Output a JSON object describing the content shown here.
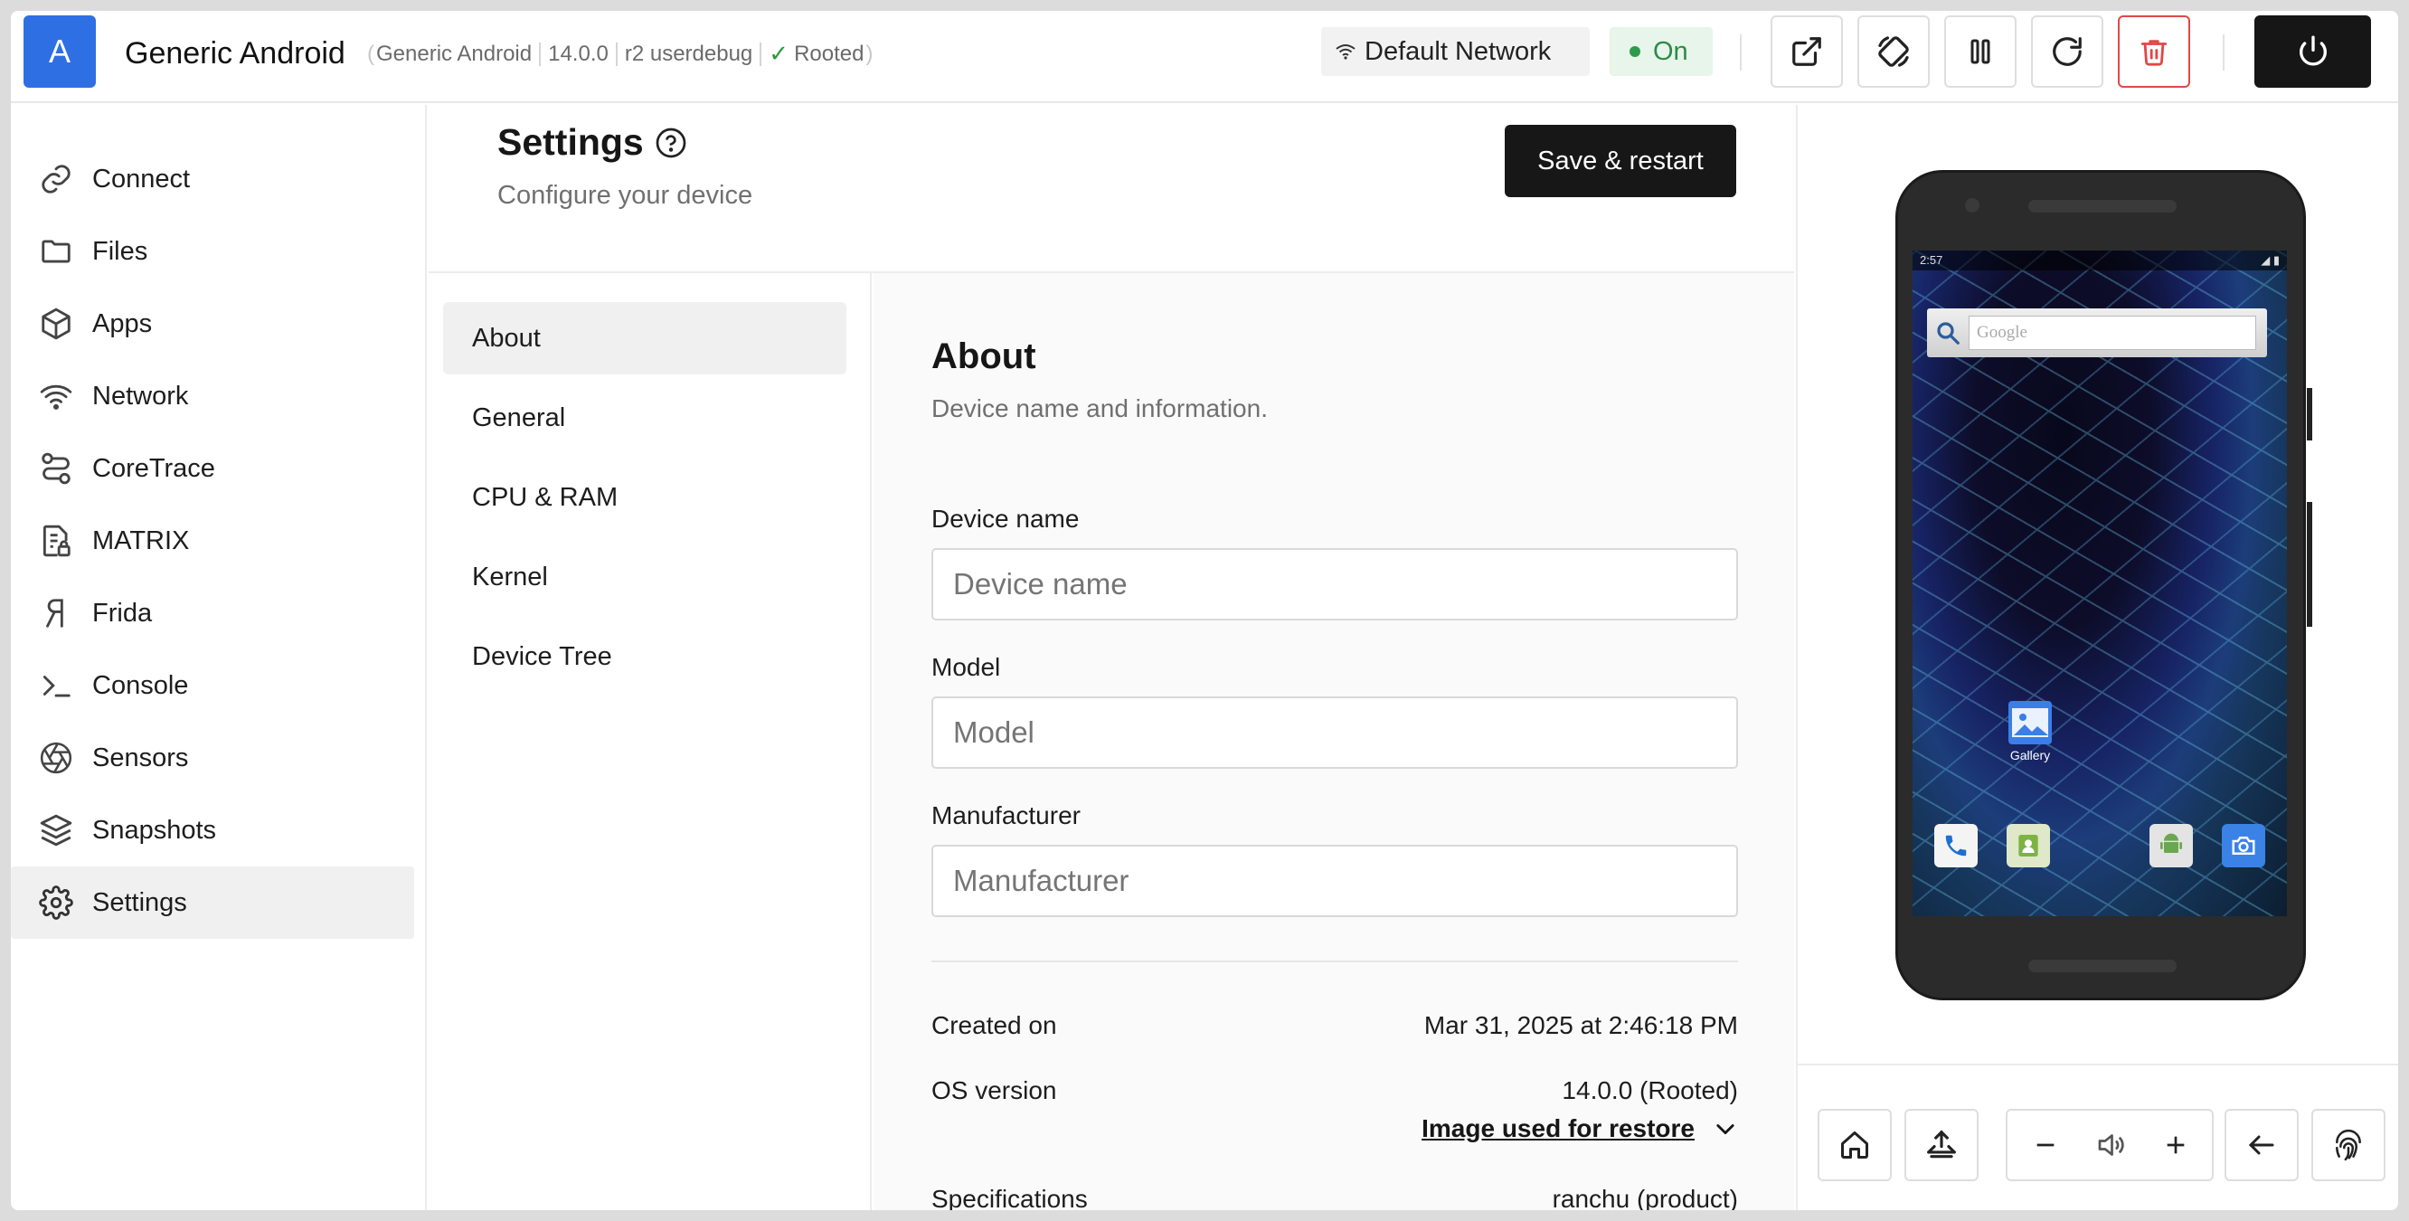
{
  "header": {
    "avatar_letter": "A",
    "device_title": "Generic Android",
    "meta": {
      "name": "Generic Android",
      "version": "14.0.0",
      "build": "r2 userdebug",
      "rooted": "Rooted"
    },
    "network_label": "Default Network",
    "network_status": "On",
    "buttons": [
      "open-external",
      "rotate",
      "pause",
      "refresh",
      "delete",
      "power"
    ],
    "colors": {
      "accent": "#2f6fe4",
      "on_green": "#2e8b45",
      "danger": "#e04848",
      "dark": "#171717"
    }
  },
  "sidebar": {
    "items": [
      {
        "label": "Connect",
        "icon": "link-icon"
      },
      {
        "label": "Files",
        "icon": "folder-icon"
      },
      {
        "label": "Apps",
        "icon": "cube-icon"
      },
      {
        "label": "Network",
        "icon": "wifi-icon"
      },
      {
        "label": "CoreTrace",
        "icon": "route-icon"
      },
      {
        "label": "MATRIX",
        "icon": "file-lock-icon"
      },
      {
        "label": "Frida",
        "icon": "frida-icon"
      },
      {
        "label": "Console",
        "icon": "terminal-icon"
      },
      {
        "label": "Sensors",
        "icon": "aperture-icon"
      },
      {
        "label": "Snapshots",
        "icon": "layers-icon"
      },
      {
        "label": "Settings",
        "icon": "gear-icon",
        "active": true
      }
    ]
  },
  "settings": {
    "title": "Settings",
    "subtitle": "Configure your device",
    "save_label": "Save & restart"
  },
  "subnav": {
    "items": [
      {
        "label": "About",
        "active": true
      },
      {
        "label": "General"
      },
      {
        "label": "CPU & RAM"
      },
      {
        "label": "Kernel"
      },
      {
        "label": "Device Tree"
      }
    ]
  },
  "about": {
    "title": "About",
    "subtitle": "Device name and information.",
    "fields": [
      {
        "label": "Device name",
        "placeholder": "Device name",
        "value": ""
      },
      {
        "label": "Model",
        "placeholder": "Model",
        "value": ""
      },
      {
        "label": "Manufacturer",
        "placeholder": "Manufacturer",
        "value": ""
      }
    ],
    "info": {
      "created_label": "Created on",
      "created_value": "Mar 31, 2025 at 2:46:18 PM",
      "os_label": "OS version",
      "os_value": "14.0.0 (Rooted)",
      "restore_link": "Image used for restore",
      "spec_label": "Specifications",
      "spec_value": "ranchu (product)"
    }
  },
  "device_screen": {
    "time": "2:57",
    "search_hint": "Google",
    "gallery_label": "Gallery",
    "dock_apps": [
      "phone-icon",
      "contacts-icon",
      "android-icon",
      "camera-icon"
    ]
  },
  "controls": [
    "home-icon",
    "screenshot-icon",
    "volume-down-icon",
    "volume-icon",
    "volume-up-icon",
    "back-icon",
    "fingerprint-icon"
  ]
}
